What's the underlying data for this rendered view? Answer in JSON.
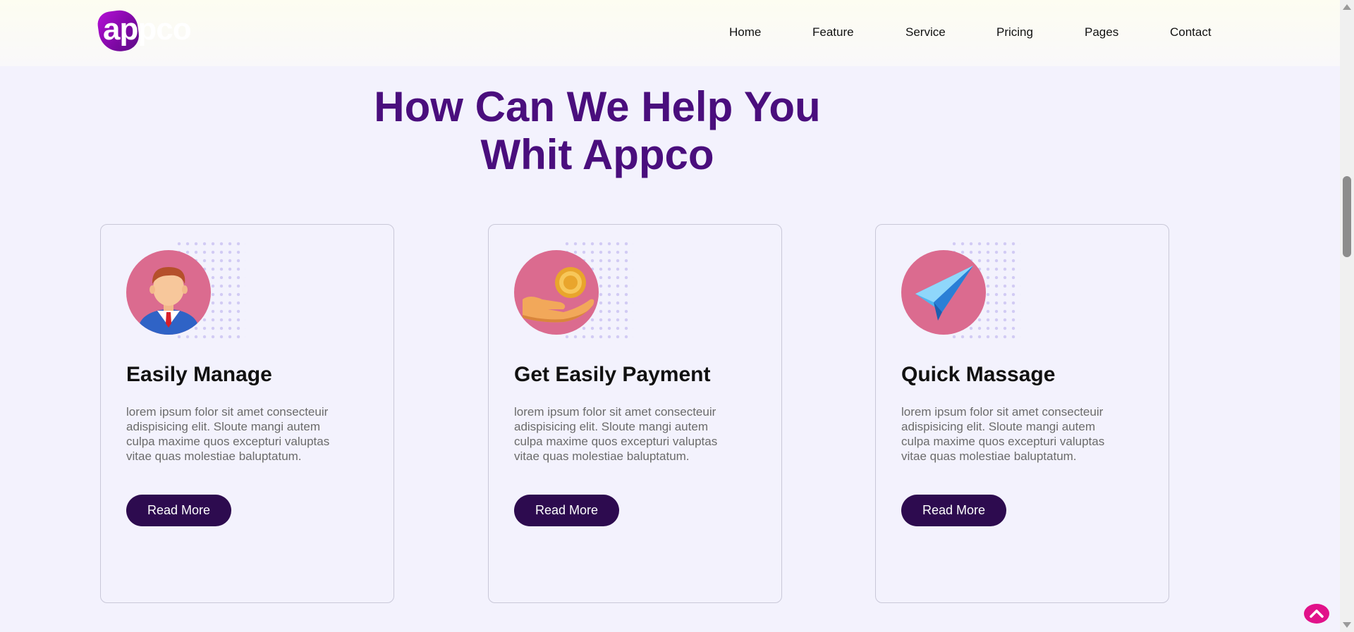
{
  "header": {
    "logo_text": "appco",
    "nav": [
      {
        "label": "Home"
      },
      {
        "label": "Feature"
      },
      {
        "label": "Service"
      },
      {
        "label": "Pricing"
      },
      {
        "label": "Pages"
      },
      {
        "label": "Contact"
      }
    ]
  },
  "section": {
    "heading_line1": "How Can We Help You",
    "heading_line2": "Whit Appco"
  },
  "cards": [
    {
      "title": "Easily Manage",
      "description": "lorem ipsum folor sit amet consecteuir adispisicing elit. Sloute mangi autem culpa maxime quos excepturi valuptas vitae quas molestiae baluptatum.",
      "button_label": "Read More",
      "icon": "businessman-icon"
    },
    {
      "title": "Get Easily Payment",
      "description": "lorem ipsum folor sit amet consecteuir adispisicing elit. Sloute mangi autem culpa maxime quos excepturi valuptas vitae quas molestiae baluptatum.",
      "button_label": "Read More",
      "icon": "coin-hand-icon"
    },
    {
      "title": "Quick Massage",
      "description": "lorem ipsum folor sit amet consecteuir adispisicing elit. Sloute mangi autem culpa maxime quos excepturi valuptas vitae quas molestiae baluptatum.",
      "button_label": "Read More",
      "icon": "paper-plane-icon"
    }
  ],
  "colors": {
    "heading": "#4a0e7d",
    "button": "#2d0b4f",
    "icon_circle": "#db6b8f",
    "scroll_top": "#e1128a",
    "background": "#f3f2fd"
  }
}
